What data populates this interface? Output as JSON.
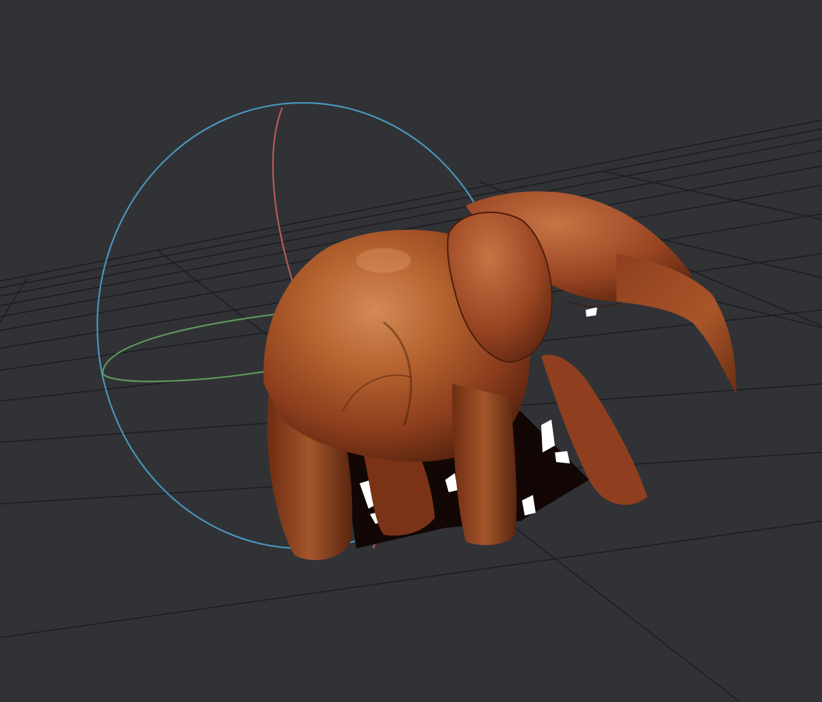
{
  "viewport": {
    "background": "#313236",
    "grid_color": "#1e1f22",
    "grid_visible": true
  },
  "gizmo": {
    "type": "rotate",
    "axes": [
      {
        "name": "x-axis",
        "color": "#b85c5c"
      },
      {
        "name": "y-axis",
        "color": "#5e9b5e"
      },
      {
        "name": "z-axis",
        "color": "#4a97bf"
      }
    ]
  },
  "model": {
    "subject": "elephant",
    "texture_colors": [
      "#8a3c1c",
      "#b5622f",
      "#5b2510",
      "#d48a55"
    ]
  }
}
